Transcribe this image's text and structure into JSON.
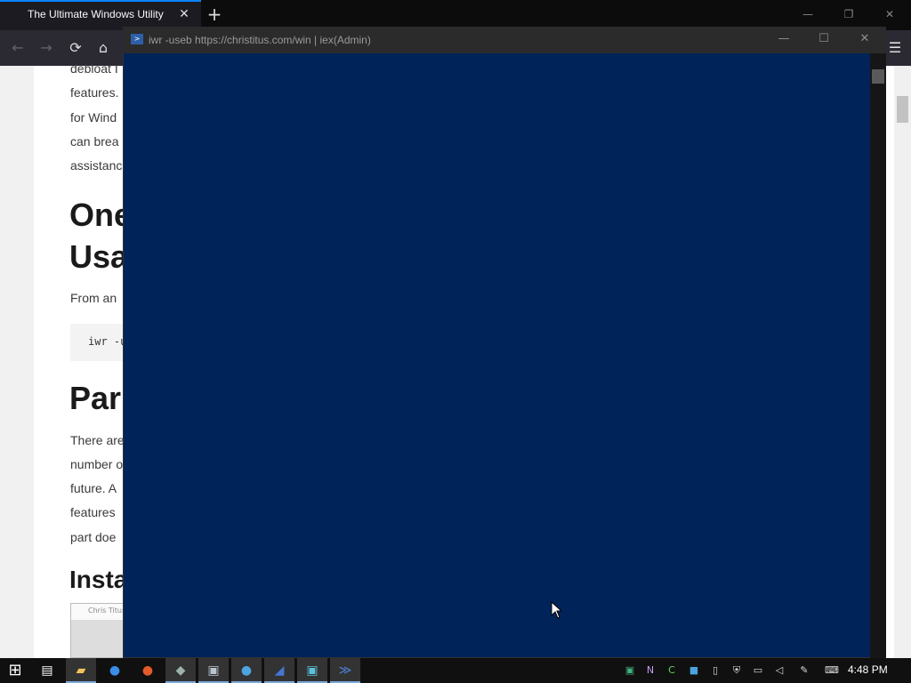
{
  "browser": {
    "tab_title": "The Ultimate Windows Utility",
    "tab_close": "✕",
    "new_tab": "+",
    "window_controls": {
      "minimize": "—",
      "restore": "❐",
      "close": "✕"
    },
    "nav": {
      "back": "←",
      "forward": "→",
      "reload": "⟳",
      "home": "⌂",
      "menu": "☰"
    }
  },
  "page": {
    "paragraph_1": [
      "debloat I",
      "features.",
      "for Wind",
      "can brea",
      "assistanc"
    ],
    "heading_1": [
      "One",
      "Usa"
    ],
    "from_text": "From an",
    "code": "iwr -u",
    "heading_2": "Par",
    "paragraph_2": [
      "There are",
      "number o",
      "future. A",
      "features",
      "part doe"
    ],
    "heading_3": "Insta",
    "thumb_text": "Chris Titus"
  },
  "console": {
    "title": "iwr -useb https://christitus.com/win | iex(Admin)",
    "icon": "powershell-icon",
    "controls": {
      "minimize": "—",
      "maximize": "☐",
      "close": "✕"
    },
    "background": "#00235a"
  },
  "taskbar": {
    "start": "⊞",
    "clock": "4:48 PM",
    "apps": [
      "start-button",
      "task-view",
      "file-explorer",
      "thunderbird",
      "firefox",
      "app-1",
      "app-2",
      "app-3",
      "app-4",
      "app-5",
      "powershell"
    ]
  }
}
